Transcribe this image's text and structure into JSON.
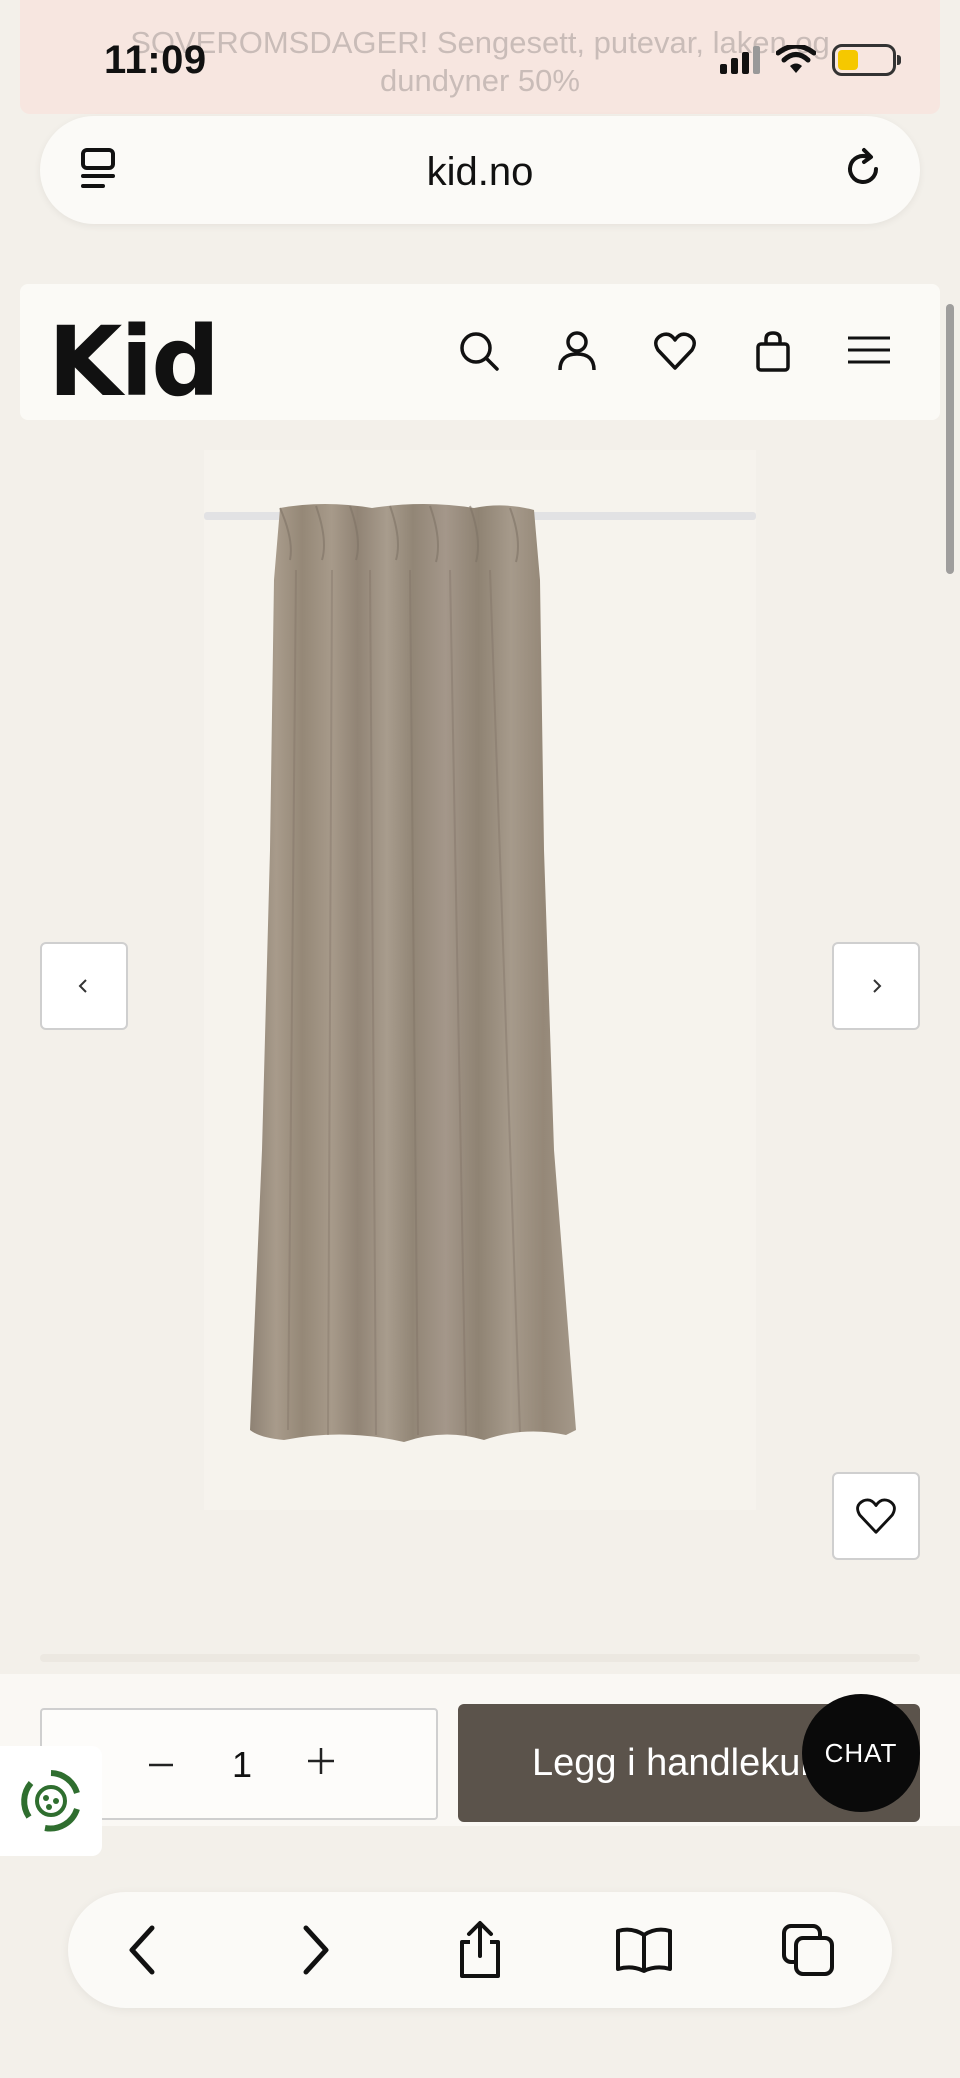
{
  "status_bar": {
    "time": "11:09"
  },
  "promo": {
    "line1": "SOVEROMSDAGER! Sengesett, putevar, laken og",
    "line2": "dundyner 50%"
  },
  "browser": {
    "url": "kid.no"
  },
  "site": {
    "logo": "Kid"
  },
  "header_icons": [
    "search-icon",
    "user-icon",
    "heart-icon",
    "bag-icon",
    "menu-icon"
  ],
  "product": {
    "image_alt": "curtain",
    "quantity": "1",
    "add_to_cart_label": "Legg i handlekurv"
  },
  "chat": {
    "label": "CHAT"
  },
  "colors": {
    "cart_button": "#5b534b",
    "curtain": "#9c8f80",
    "background": "#f3f0ea"
  }
}
